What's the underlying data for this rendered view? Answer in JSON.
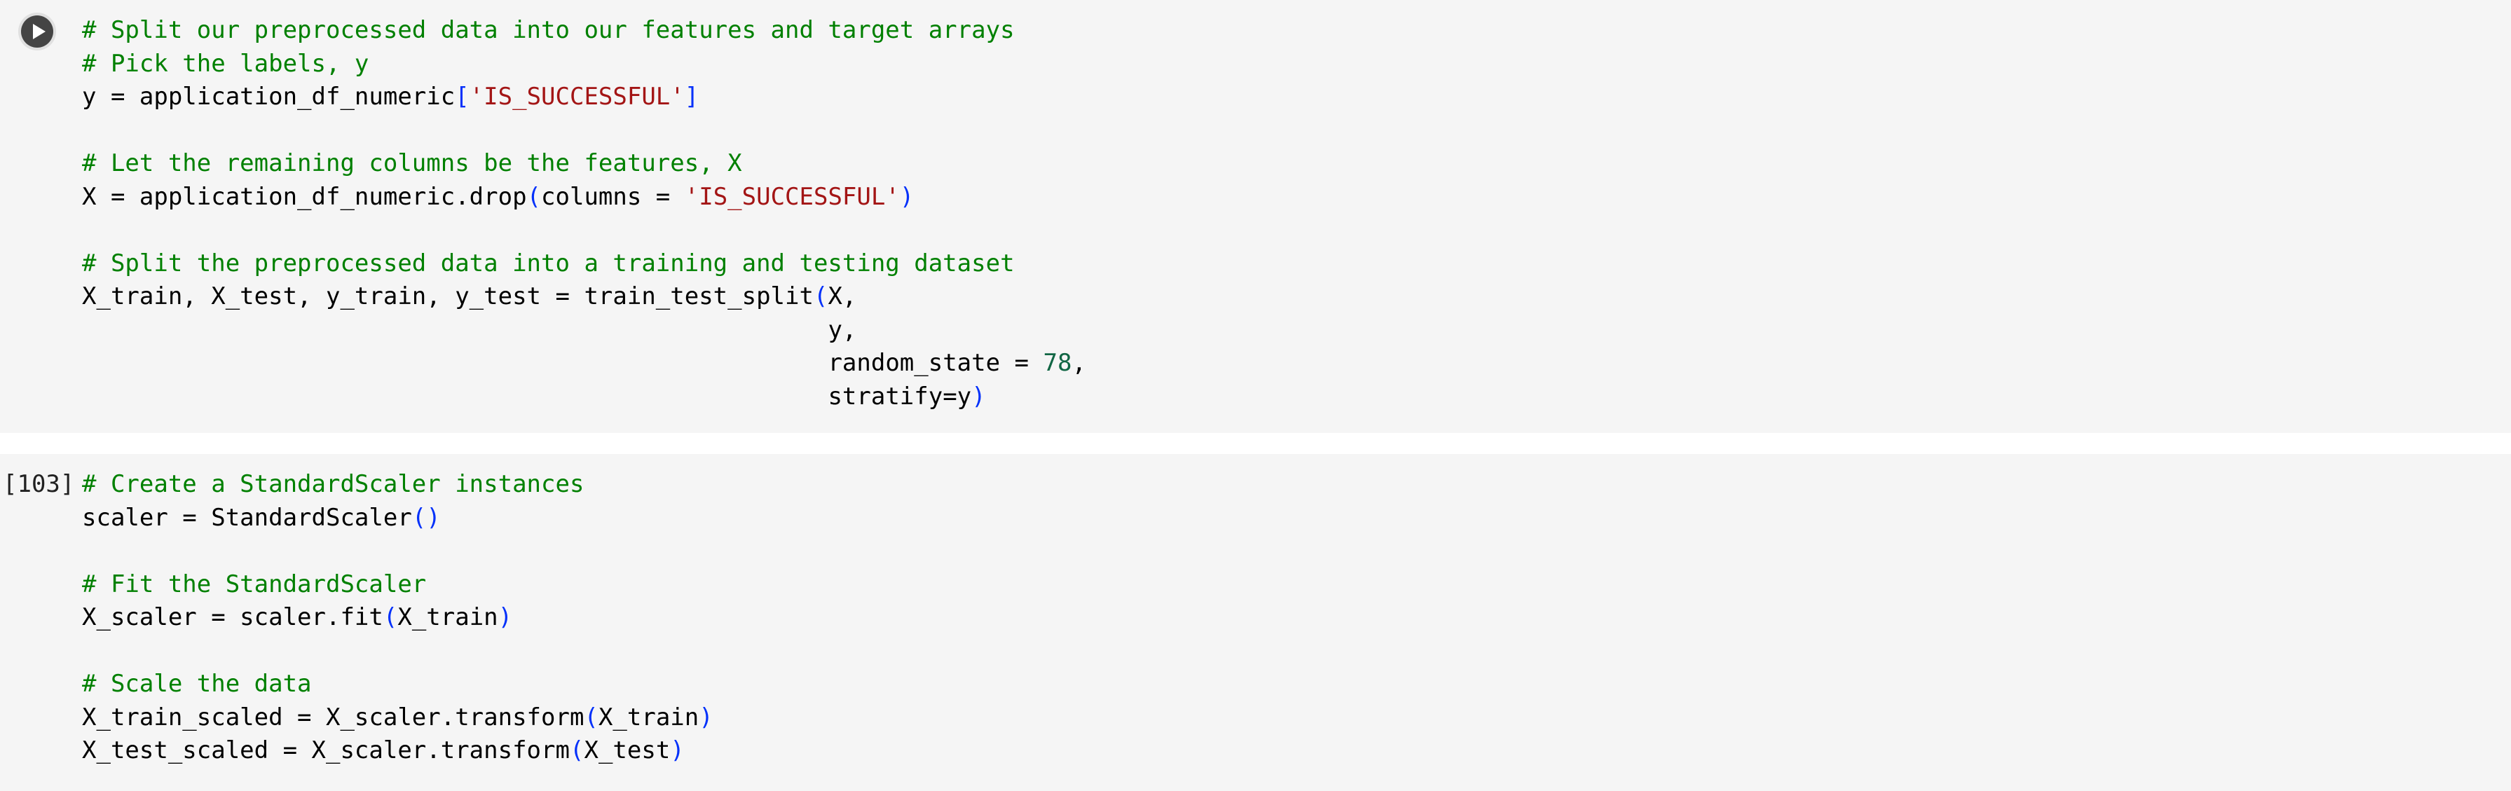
{
  "cells": [
    {
      "execution_count": "",
      "run_icon": "play-circle-icon",
      "lines": {
        "l1": "# Split our preprocessed data into our features and target arrays",
        "l2": "# Pick the labels, y",
        "l3a": "y = application_df_numeric",
        "l3b": "[",
        "l3c": "'IS_SUCCESSFUL'",
        "l3d": "]",
        "l5": "# Let the remaining columns be the features, X",
        "l6a": "X = application_df_numeric.drop",
        "l6b": "(",
        "l6c": "columns = ",
        "l6d": "'IS_SUCCESSFUL'",
        "l6e": ")",
        "l8": "# Split the preprocessed data into a training and testing dataset",
        "l9a": "X_train, X_test, y_train, y_test = train_test_split",
        "l9b": "(",
        "l9c": "X,",
        "l10": "y,",
        "l11a": "random_state = ",
        "l11b": "78",
        "l11c": ",",
        "l12a": "stratify=y",
        "l12b": ")"
      }
    },
    {
      "execution_count": "[103]",
      "lines": {
        "l1": "# Create a StandardScaler instances",
        "l2a": "scaler = StandardScaler",
        "l2b": "()",
        "l4": "# Fit the StandardScaler",
        "l5a": "X_scaler = scaler.fit",
        "l5b": "(",
        "l5c": "X_train",
        "l5d": ")",
        "l7": "# Scale the data",
        "l8a": "X_train_scaled = X_scaler.transform",
        "l8b": "(",
        "l8c": "X_train",
        "l8d": ")",
        "l9a": "X_test_scaled = X_scaler.transform",
        "l9b": "(",
        "l9c": "X_test",
        "l9d": ")"
      }
    }
  ],
  "colors": {
    "cell_background": "#f5f5f5",
    "comment": "#008000",
    "string": "#a31515",
    "number": "#116644",
    "bracket": "#0431fa",
    "run_button": "#444444"
  }
}
